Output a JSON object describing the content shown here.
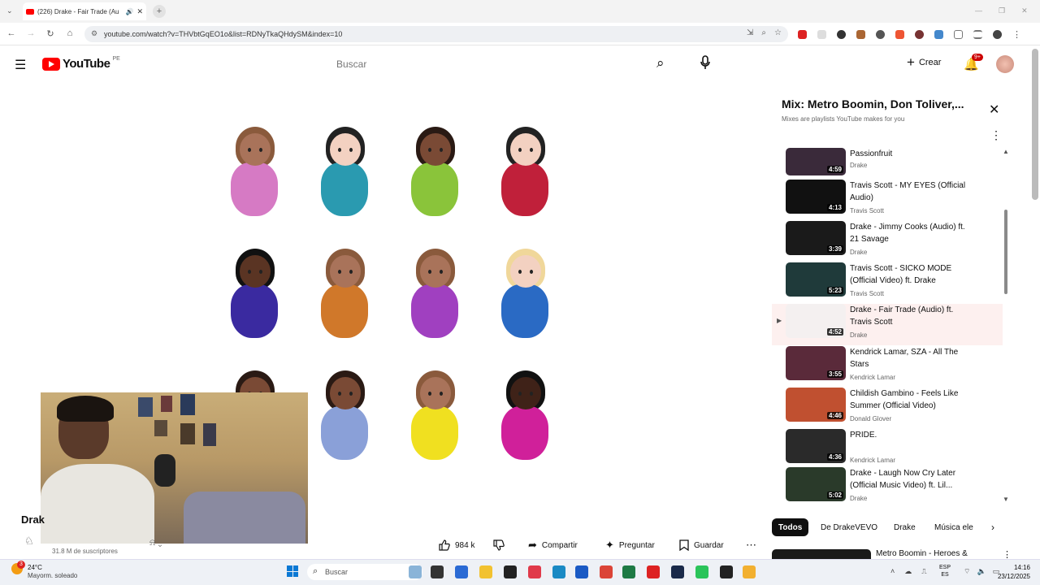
{
  "browser": {
    "tab_title": "(226) Drake - Fair Trade (Au",
    "url": "youtube.com/watch?v=THVbtGqEO1o&list=RDNyTkaQHdySM&index=10"
  },
  "youtube": {
    "logo_text": "YouTube",
    "country": "PE",
    "search_placeholder": "Buscar",
    "create_label": "Crear",
    "notifications_badge": "9+"
  },
  "video": {
    "channel_partial": "Drak",
    "subscribers": "31.8 M de suscriptores",
    "likes": "984 k",
    "share_label": "Compartir",
    "ask_label": "Preguntar",
    "save_label": "Guardar"
  },
  "playlist": {
    "title": "Mix: Metro Boomin, Don Toliver,...",
    "subtitle": "Mixes are playlists YouTube makes for you",
    "items": [
      {
        "title": "Passionfruit",
        "channel": "Drake",
        "duration": "4:59",
        "color": "#3a2a3a"
      },
      {
        "title": "Travis Scott - MY EYES (Official Audio)",
        "channel": "Travis Scott",
        "duration": "4:13",
        "color": "#111111"
      },
      {
        "title": "Drake - Jimmy Cooks (Audio) ft. 21 Savage",
        "channel": "Drake",
        "duration": "3:39",
        "color": "#1a1a1a"
      },
      {
        "title": "Travis Scott - SICKO MODE (Official Video) ft. Drake",
        "channel": "Travis Scott",
        "duration": "5:23",
        "color": "#1f3a3a"
      },
      {
        "title": "Drake - Fair Trade (Audio) ft. Travis Scott",
        "channel": "Drake",
        "duration": "4:52",
        "color": "#f4f0f0"
      },
      {
        "title": "Kendrick Lamar, SZA - All The Stars",
        "channel": "Kendrick Lamar",
        "duration": "3:55",
        "color": "#5a2a3a"
      },
      {
        "title": "Childish Gambino - Feels Like Summer (Official Video)",
        "channel": "Donald Glover",
        "duration": "4:46",
        "color": "#c05030"
      },
      {
        "title": "PRIDE.",
        "channel": "Kendrick Lamar",
        "duration": "4:36",
        "color": "#2a2a2a"
      },
      {
        "title": "Drake - Laugh Now Cry Later (Official Music Video) ft. Lil...",
        "channel": "Drake",
        "duration": "5:02",
        "color": "#2a3a2a"
      }
    ],
    "chips": [
      "Todos",
      "De DrakeVEVO",
      "Drake",
      "Música ele"
    ],
    "next_video_title": "Metro Boomin - Heroes &"
  },
  "taskbar": {
    "weather_temp": "24°C",
    "weather_desc": "Mayorm. soleado",
    "weather_badge": "3",
    "search_placeholder": "Buscar",
    "lang_top": "ESP",
    "lang_bottom": "ES",
    "time": "14:16",
    "date": "23/12/2025"
  },
  "emoji_colors": {
    "skin": [
      "#a9735a",
      "#f3d1c1",
      "#7a4a35",
      "#f3d1c1",
      "#5a3423",
      "#a9735a",
      "#a9735a",
      "#f3d1c1",
      "#7a4a35",
      "#7a4a35",
      "#a9735a",
      "#3f2218"
    ],
    "hair": [
      "#8a5a3c",
      "#222222",
      "#2a1a14",
      "#222222",
      "#111111",
      "#8a5a3c",
      "#8a5a3c",
      "#f0d79a",
      "#2a1a14",
      "#2a1a14",
      "#8a5a3c",
      "#111111"
    ],
    "shirt": [
      "#d67ac4",
      "#2a9ab0",
      "#8ac43a",
      "#c0203a",
      "#3a2aa0",
      "#d0782a",
      "#a040c0",
      "#2a6ac4",
      "#c08a60",
      "#8aa0d8",
      "#f0e020",
      "#d0209a"
    ]
  }
}
